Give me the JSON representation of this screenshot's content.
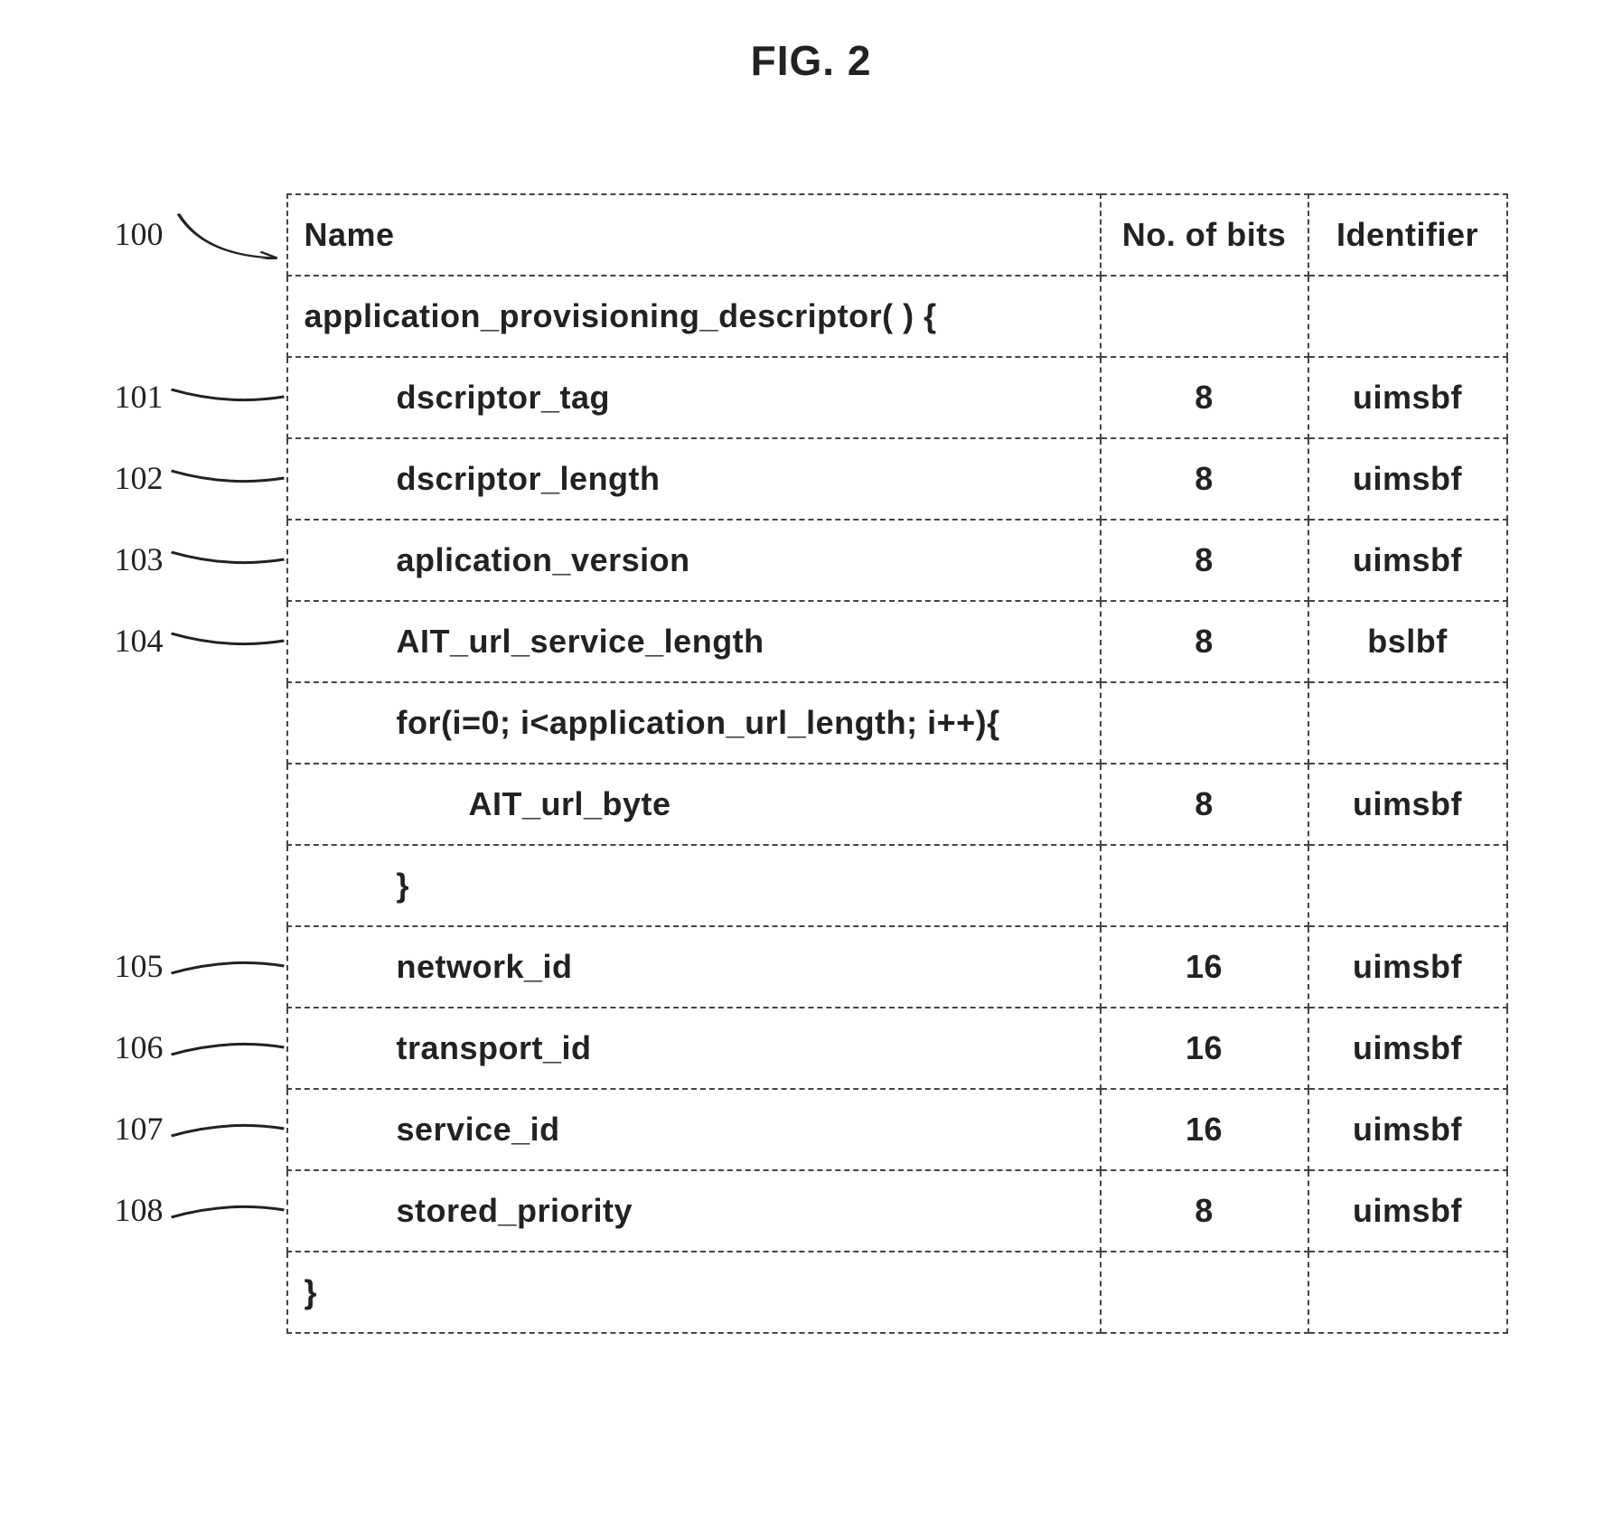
{
  "figure_title": "FIG. 2",
  "labels": {
    "ref100": "100",
    "ref101": "101",
    "ref102": "102",
    "ref103": "103",
    "ref104": "104",
    "ref105": "105",
    "ref106": "106",
    "ref107": "107",
    "ref108": "108"
  },
  "headers": {
    "name": "Name",
    "bits": "No. of bits",
    "ident": "Identifier"
  },
  "rows": [
    {
      "name": "application_provisioning_descriptor( ) {",
      "bits": "",
      "ident": "",
      "indent": 0
    },
    {
      "name": "dscriptor_tag",
      "bits": "8",
      "ident": "uimsbf",
      "indent": 1
    },
    {
      "name": "dscriptor_length",
      "bits": "8",
      "ident": "uimsbf",
      "indent": 1
    },
    {
      "name": "aplication_version",
      "bits": "8",
      "ident": "uimsbf",
      "indent": 1
    },
    {
      "name": "AIT_url_service_length",
      "bits": "8",
      "ident": "bslbf",
      "indent": 1
    },
    {
      "name": "for(i=0; i<application_url_length; i++){",
      "bits": "",
      "ident": "",
      "indent": 1
    },
    {
      "name": "AIT_url_byte",
      "bits": "8",
      "ident": "uimsbf",
      "indent": 2
    },
    {
      "name": "}",
      "bits": "",
      "ident": "",
      "indent": 1
    },
    {
      "name": "network_id",
      "bits": "16",
      "ident": "uimsbf",
      "indent": 1
    },
    {
      "name": "transport_id",
      "bits": "16",
      "ident": "uimsbf",
      "indent": 1
    },
    {
      "name": "service_id",
      "bits": "16",
      "ident": "uimsbf",
      "indent": 1
    },
    {
      "name": "stored_priority",
      "bits": "8",
      "ident": "uimsbf",
      "indent": 1
    },
    {
      "name": "}",
      "bits": "",
      "ident": "",
      "indent": 0
    }
  ]
}
